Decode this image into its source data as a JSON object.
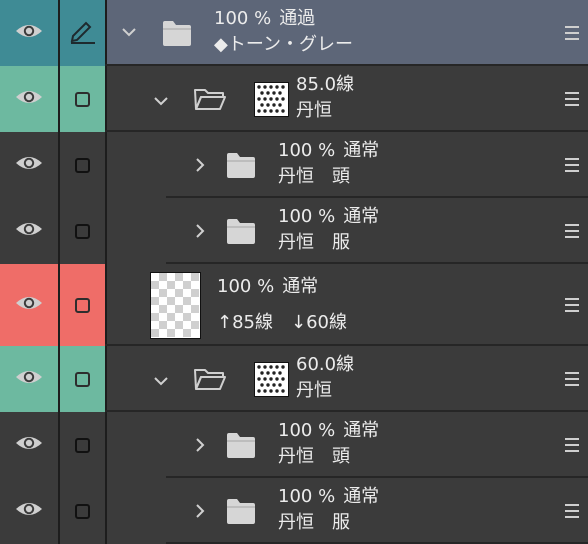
{
  "colors": {
    "panel_bg": "#3b3b3b",
    "selected_row": "#5d6678",
    "teal": "#3f8b95",
    "green": "#6db9a0",
    "red": "#ef6d68"
  },
  "rows": [
    {
      "type": "folder",
      "opacity": "100 %",
      "blend": "通過",
      "name": "◆トーン・グレー",
      "expanded": true,
      "col1": "teal",
      "col2": "teal",
      "col2_icon": "pen-icon",
      "thumb": false,
      "indent": 0
    },
    {
      "type": "folder",
      "opacity": "85.0",
      "blend": "線",
      "name": "丹恒",
      "expanded": true,
      "col1": "green",
      "col2": "green",
      "col2_icon": "checkbox",
      "thumb": true,
      "indent": 1
    },
    {
      "type": "folder",
      "opacity": "100 %",
      "blend": "通常",
      "name": "丹恒　頭",
      "expanded": false,
      "col1": "none",
      "col2": "none",
      "col2_icon": "checkbox",
      "thumb": false,
      "indent": 2
    },
    {
      "type": "folder",
      "opacity": "100 %",
      "blend": "通常",
      "name": "丹恒　服",
      "expanded": false,
      "col1": "none",
      "col2": "none",
      "col2_icon": "checkbox",
      "thumb": false,
      "indent": 2
    },
    {
      "type": "layer",
      "opacity": "100 %",
      "blend": "通常",
      "name": "↑85線　↓60線",
      "col1": "red",
      "col2": "red",
      "col2_icon": "checkbox",
      "thumb": true,
      "indent": 0
    },
    {
      "type": "folder",
      "opacity": "60.0",
      "blend": "線",
      "name": "丹恒",
      "expanded": true,
      "col1": "green",
      "col2": "green",
      "col2_icon": "checkbox",
      "thumb": true,
      "indent": 1
    },
    {
      "type": "folder",
      "opacity": "100 %",
      "blend": "通常",
      "name": "丹恒　頭",
      "expanded": false,
      "col1": "none",
      "col2": "none",
      "col2_icon": "checkbox",
      "thumb": false,
      "indent": 2
    },
    {
      "type": "folder",
      "opacity": "100 %",
      "blend": "通常",
      "name": "丹恒　服",
      "expanded": false,
      "col1": "none",
      "col2": "none",
      "col2_icon": "checkbox",
      "thumb": false,
      "indent": 2
    }
  ]
}
